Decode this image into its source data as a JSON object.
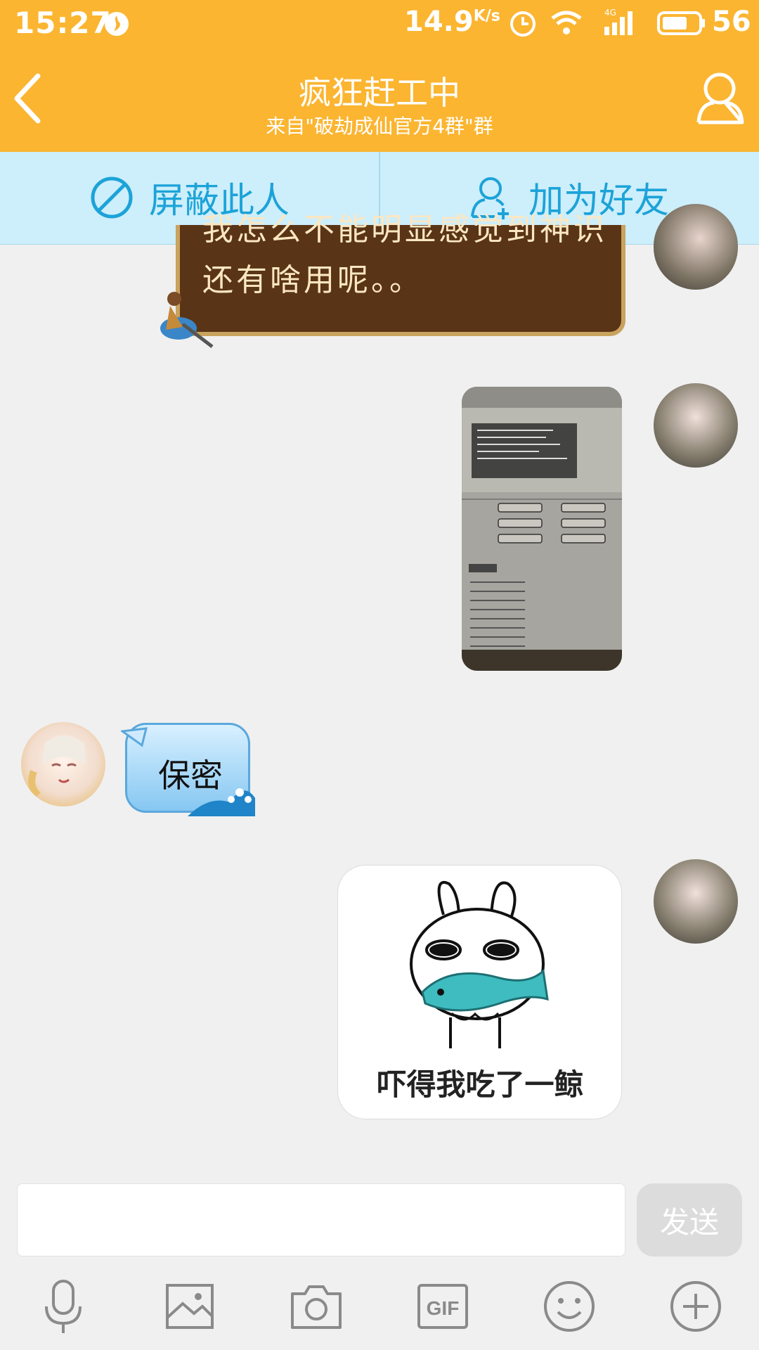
{
  "status": {
    "time": "15:27",
    "speed": "14.9",
    "speed_unit": "K/s",
    "battery": "56",
    "network": "4G"
  },
  "header": {
    "title": "疯狂赶工中",
    "subtitle": "来自\"破劫成仙官方4群\"群",
    "back_icon": "back-icon",
    "profile_icon": "profile-icon"
  },
  "actions": {
    "block_label": "屏蔽此人",
    "add_label": "加为好友"
  },
  "colors": {
    "header": "#fbb531",
    "action_bar": "#cdeefb",
    "accent": "#1ca3d8"
  },
  "messages": [
    {
      "side": "right",
      "type": "text-bubble",
      "text_line1": "我怎么不能明显感觉到神识",
      "text_line2": "还有啥用呢。。"
    },
    {
      "side": "right",
      "type": "image",
      "caption": "game-screenshot"
    },
    {
      "side": "left",
      "type": "text-bubble",
      "text": "保密"
    },
    {
      "side": "right",
      "type": "sticker",
      "caption": "吓得我吃了一鲸"
    }
  ],
  "composer": {
    "placeholder": "",
    "send_label": "发送"
  },
  "toolbar": [
    "microphone-icon",
    "image-icon",
    "camera-icon",
    "gif-icon",
    "emoji-icon",
    "plus-icon"
  ],
  "toolbar_gif_text": "GIF"
}
